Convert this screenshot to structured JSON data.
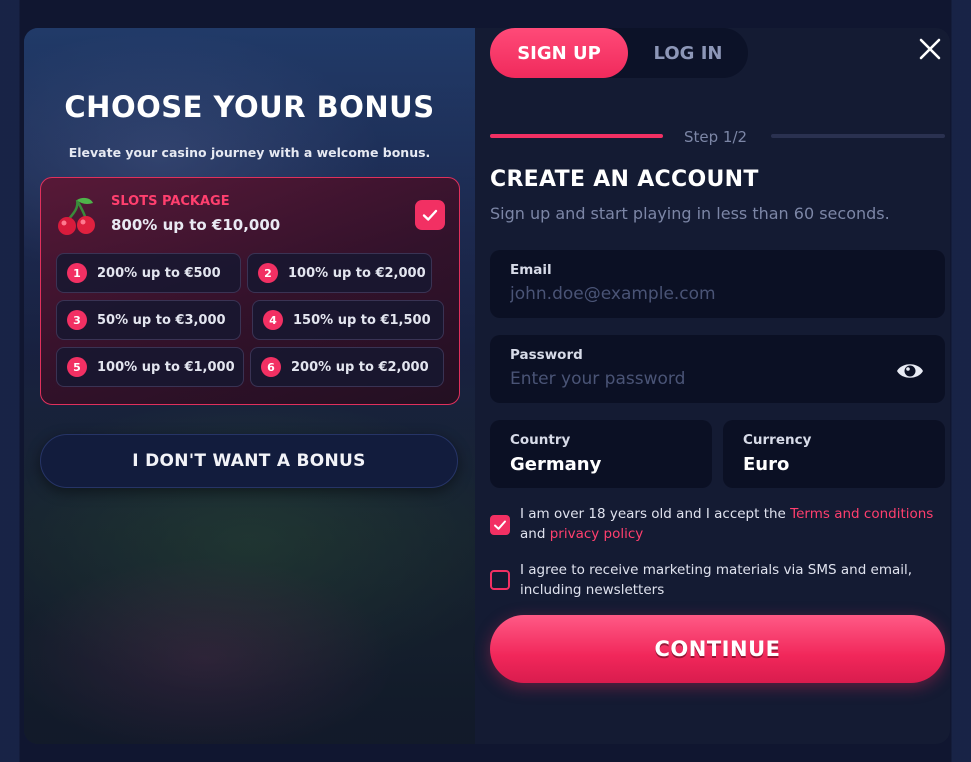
{
  "bonus": {
    "title": "CHOOSE YOUR BONUS",
    "subtitle": "Elevate your casino journey with a welcome bonus.",
    "package": {
      "name": "SLOTS PACKAGE",
      "amount": "800% up to €10,000",
      "selected": true,
      "icon": "cherry-icon"
    },
    "tiers": [
      {
        "num": "1",
        "text": "200% up to €500"
      },
      {
        "num": "2",
        "text": "100% up to €2,000"
      },
      {
        "num": "3",
        "text": "50% up to €3,000"
      },
      {
        "num": "4",
        "text": "150% up to €1,500"
      },
      {
        "num": "5",
        "text": "100% up to €1,000"
      },
      {
        "num": "6",
        "text": "200% up to €2,000"
      }
    ],
    "no_bonus_label": "I DON'T WANT A BONUS"
  },
  "tabs": {
    "signup": "SIGN UP",
    "login": "LOG IN",
    "active": "signup"
  },
  "progress": {
    "step_label": "Step 1/2",
    "fraction": 0.5
  },
  "form": {
    "title": "CREATE AN ACCOUNT",
    "subtitle": "Sign up and start playing in less than 60 seconds.",
    "email": {
      "label": "Email",
      "placeholder": "john.doe@example.com",
      "value": ""
    },
    "password": {
      "label": "Password",
      "placeholder": "Enter your password",
      "value": ""
    },
    "country": {
      "label": "Country",
      "value": "Germany"
    },
    "currency": {
      "label": "Currency",
      "value": "Euro"
    },
    "consent_age": {
      "checked": true,
      "text_before": "I am over 18 years old and I accept the ",
      "terms_link": "Terms and conditions",
      "text_middle": " and ",
      "privacy_link": "privacy policy"
    },
    "consent_marketing": {
      "checked": false,
      "text": "I agree to receive marketing materials via SMS and email, including newsletters"
    },
    "continue_label": "CONTINUE"
  },
  "colors": {
    "accent": "#f23063",
    "background": "#141b33",
    "field_bg": "#0b1024",
    "muted_text": "#7c86a6"
  }
}
